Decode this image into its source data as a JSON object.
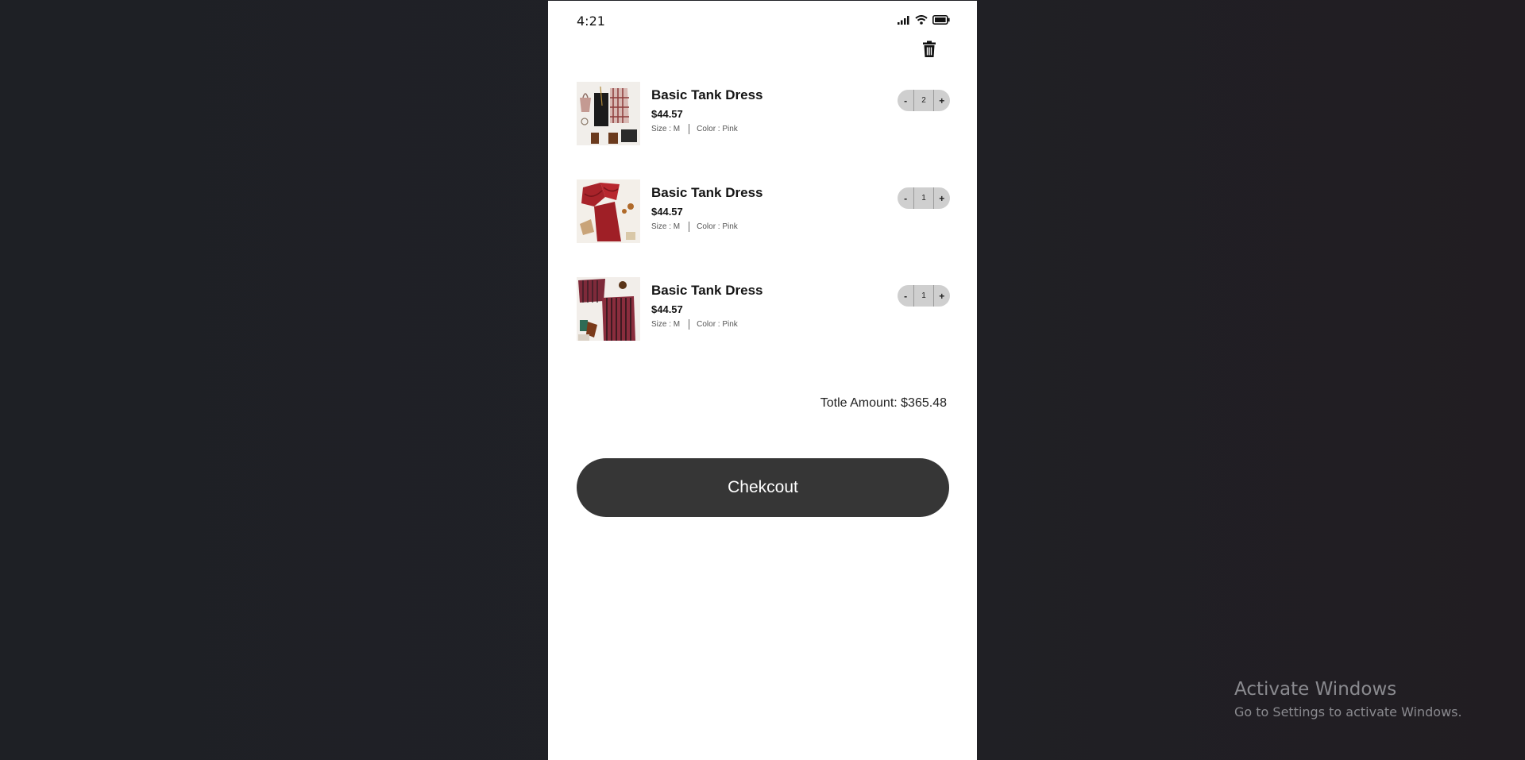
{
  "status_bar": {
    "time": "4:21",
    "icons": [
      "signal-icon",
      "wifi-icon",
      "battery-icon"
    ]
  },
  "header": {
    "delete_icon": "trash-icon"
  },
  "cart": {
    "items": [
      {
        "name": "Basic Tank Dress",
        "price": "$44.57",
        "size": "Size : M",
        "color": "Color : Pink",
        "quantity": "2",
        "minus": "-",
        "plus": "+",
        "thumbnail": "outfit-black-dress-plaid-shirt"
      },
      {
        "name": "Basic Tank Dress",
        "price": "$44.57",
        "size": "Size : M",
        "color": "Color : Pink",
        "quantity": "1",
        "minus": "-",
        "plus": "+",
        "thumbnail": "outfit-red-ruffle-jumpsuit"
      },
      {
        "name": "Basic Tank Dress",
        "price": "$44.57",
        "size": "Size : M",
        "color": "Color : Pink",
        "quantity": "1",
        "minus": "-",
        "plus": "+",
        "thumbnail": "outfit-striped-top-pants"
      }
    ],
    "total_label": "Totle Amount: $365.48",
    "checkout_label": "Chekcout"
  },
  "os_watermark": {
    "title": "Activate Windows",
    "subtitle": "Go to Settings to activate Windows."
  },
  "colors": {
    "background": "#1f2126",
    "screen": "#ffffff",
    "button": "#363636",
    "stepper": "#cfcfcf",
    "text": "#141414"
  }
}
